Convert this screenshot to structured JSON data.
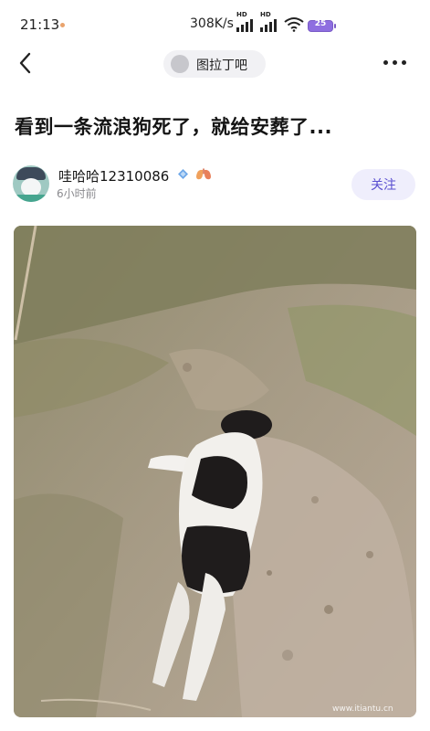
{
  "status_bar": {
    "time": "21:13",
    "net_speed": "308K/s",
    "signal_1_label": "HD",
    "signal_2_label": "HD",
    "battery_level": "25",
    "wifi_icon": "wifi-icon",
    "battery_color": "#8e6ee0"
  },
  "nav": {
    "back_icon": "chevron-left-icon",
    "forum_name": "图拉丁吧",
    "more_icon": "more-horizontal-icon"
  },
  "post": {
    "title": "看到一条流浪狗死了，就给安葬了...",
    "author": {
      "name": "哇哈哈12310086",
      "time_ago": "6小时前",
      "level_icon": "diamond-icon",
      "badge_icon": "lungs-icon"
    },
    "follow_label": "关注",
    "image_description_icon": "photo",
    "watermark": "www.itiantu.cn"
  },
  "colors": {
    "accent": "#5a4fd1",
    "follow_bg": "#efeefc",
    "chip_bg": "#f1f1f4"
  }
}
